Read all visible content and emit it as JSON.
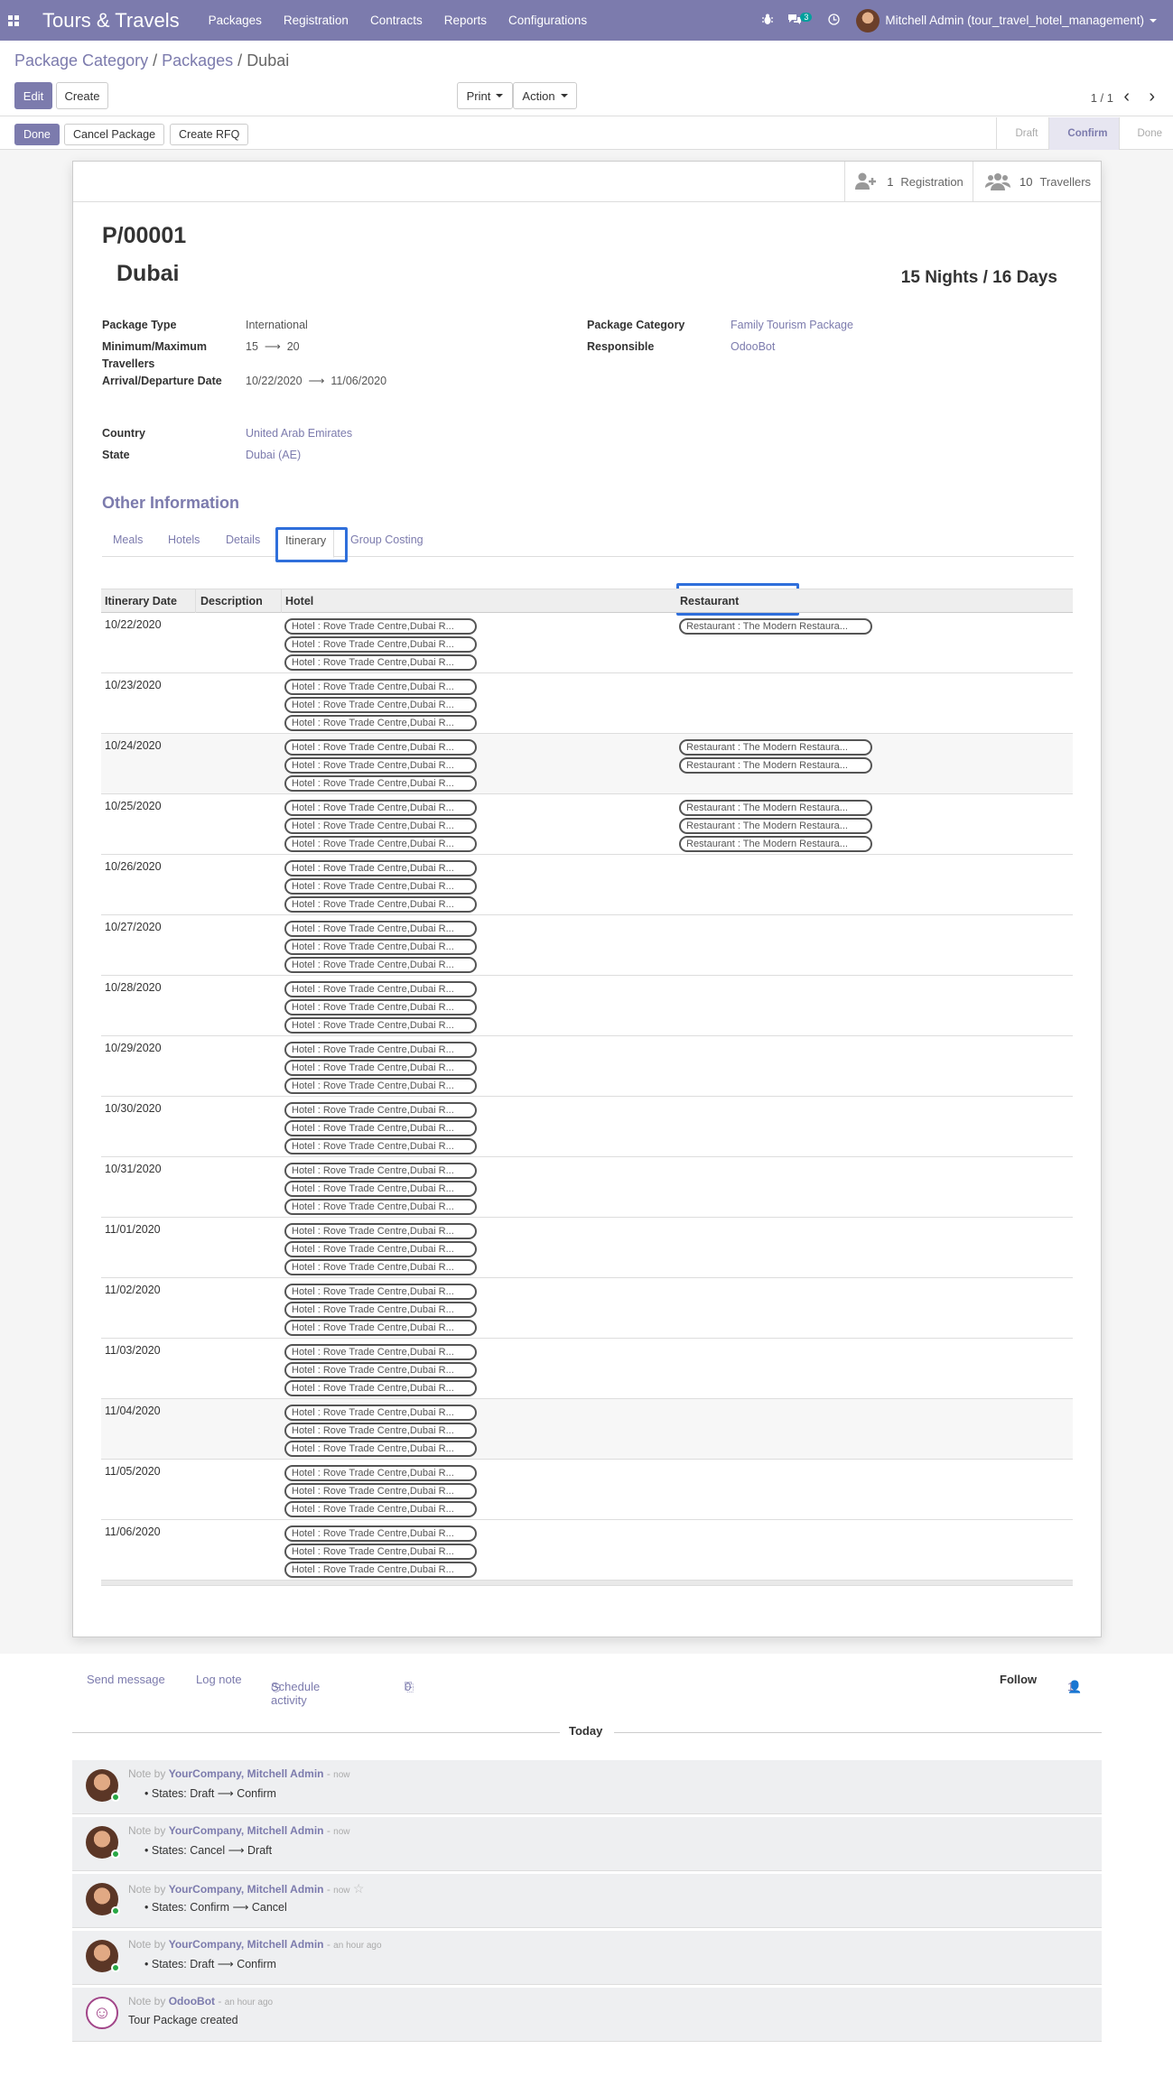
{
  "navbar": {
    "app_name": "Tours & Travels",
    "menu": [
      "Packages",
      "Registration",
      "Contracts",
      "Reports",
      "Configurations"
    ],
    "chat_count": "3",
    "user": "Mitchell Admin (tour_travel_hotel_management)",
    "brand_color": "#7c7bad"
  },
  "breadcrumb": {
    "part1": "Package Category",
    "part2": "Packages",
    "current": "Dubai"
  },
  "control": {
    "edit": "Edit",
    "create": "Create",
    "print": "Print",
    "action": "Action",
    "pager": "1 / 1"
  },
  "statusbar": {
    "done": "Done",
    "cancel_package": "Cancel Package",
    "create_rfq": "Create RFQ",
    "stages": [
      "Draft",
      "Confirm",
      "Done"
    ],
    "active_stage": "Confirm"
  },
  "smart_buttons": {
    "registration_count": "1",
    "registration_label": "Registration",
    "travellers_count": "10",
    "travellers_label": "Travellers"
  },
  "record": {
    "code": "P/00001",
    "name": "Dubai",
    "duration": "15 Nights / 16 Days",
    "package_type_label": "Package Type",
    "package_type": "International",
    "min_max_label": "Minimum/Maximum Travellers",
    "min": "15",
    "max": "20",
    "arrival_label": "Arrival/Departure Date",
    "arrival": "10/22/2020",
    "departure": "11/06/2020",
    "country_label": "Country",
    "country": "United Arab Emirates",
    "state_label": "State",
    "state": "Dubai (AE)",
    "category_label": "Package Category",
    "category": "Family Tourism Package",
    "responsible_label": "Responsible",
    "responsible": "OdooBot",
    "arrow": "⟶"
  },
  "other_info": {
    "title": "Other Information",
    "tabs": [
      "Meals",
      "Hotels",
      "Details",
      "Itinerary",
      "Group Costing"
    ],
    "active_tab": "Itinerary"
  },
  "itinerary": {
    "columns": [
      "Itinerary Date",
      "Description",
      "Hotel",
      "Restaurant"
    ],
    "hotel_tag": "Hotel : Rove Trade Centre,Dubai R...",
    "restaurant_tag": "Restaurant : The Modern Restaura...",
    "rows": [
      {
        "date": "10/22/2020",
        "hotels": 3,
        "restaurants": 1
      },
      {
        "date": "10/23/2020",
        "hotels": 3,
        "restaurants": 0
      },
      {
        "date": "10/24/2020",
        "hotels": 3,
        "restaurants": 2
      },
      {
        "date": "10/25/2020",
        "hotels": 3,
        "restaurants": 3
      },
      {
        "date": "10/26/2020",
        "hotels": 3,
        "restaurants": 0
      },
      {
        "date": "10/27/2020",
        "hotels": 3,
        "restaurants": 0
      },
      {
        "date": "10/28/2020",
        "hotels": 3,
        "restaurants": 0
      },
      {
        "date": "10/29/2020",
        "hotels": 3,
        "restaurants": 0
      },
      {
        "date": "10/30/2020",
        "hotels": 3,
        "restaurants": 0
      },
      {
        "date": "10/31/2020",
        "hotels": 3,
        "restaurants": 0
      },
      {
        "date": "11/01/2020",
        "hotels": 3,
        "restaurants": 0
      },
      {
        "date": "11/02/2020",
        "hotels": 3,
        "restaurants": 0
      },
      {
        "date": "11/03/2020",
        "hotels": 3,
        "restaurants": 0
      },
      {
        "date": "11/04/2020",
        "hotels": 3,
        "restaurants": 0
      },
      {
        "date": "11/05/2020",
        "hotels": 3,
        "restaurants": 0
      },
      {
        "date": "11/06/2020",
        "hotels": 3,
        "restaurants": 0
      }
    ]
  },
  "chatter": {
    "send_message": "Send message",
    "log_note": "Log note",
    "schedule_activity": "Schedule activity",
    "attachments": "0",
    "follow": "Follow",
    "followers": "1",
    "today": "Today",
    "messages": [
      {
        "prefix": "Note by",
        "author": "YourCompany, Mitchell Admin",
        "time": "now",
        "body": "States: Draft ⟶ Confirm",
        "bot": false
      },
      {
        "prefix": "Note by",
        "author": "YourCompany, Mitchell Admin",
        "time": "now",
        "body": "States: Cancel ⟶ Draft",
        "bot": false
      },
      {
        "prefix": "Note by",
        "author": "YourCompany, Mitchell Admin",
        "time": "now",
        "body": "States: Confirm ⟶ Cancel",
        "bot": false,
        "star": true
      },
      {
        "prefix": "Note by",
        "author": "YourCompany, Mitchell Admin",
        "time": "an hour ago",
        "body": "States: Draft ⟶ Confirm",
        "bot": false
      },
      {
        "prefix": "Note by",
        "author": "OdooBot",
        "time": "an hour ago",
        "body": "Tour Package created",
        "bot": true
      }
    ]
  }
}
